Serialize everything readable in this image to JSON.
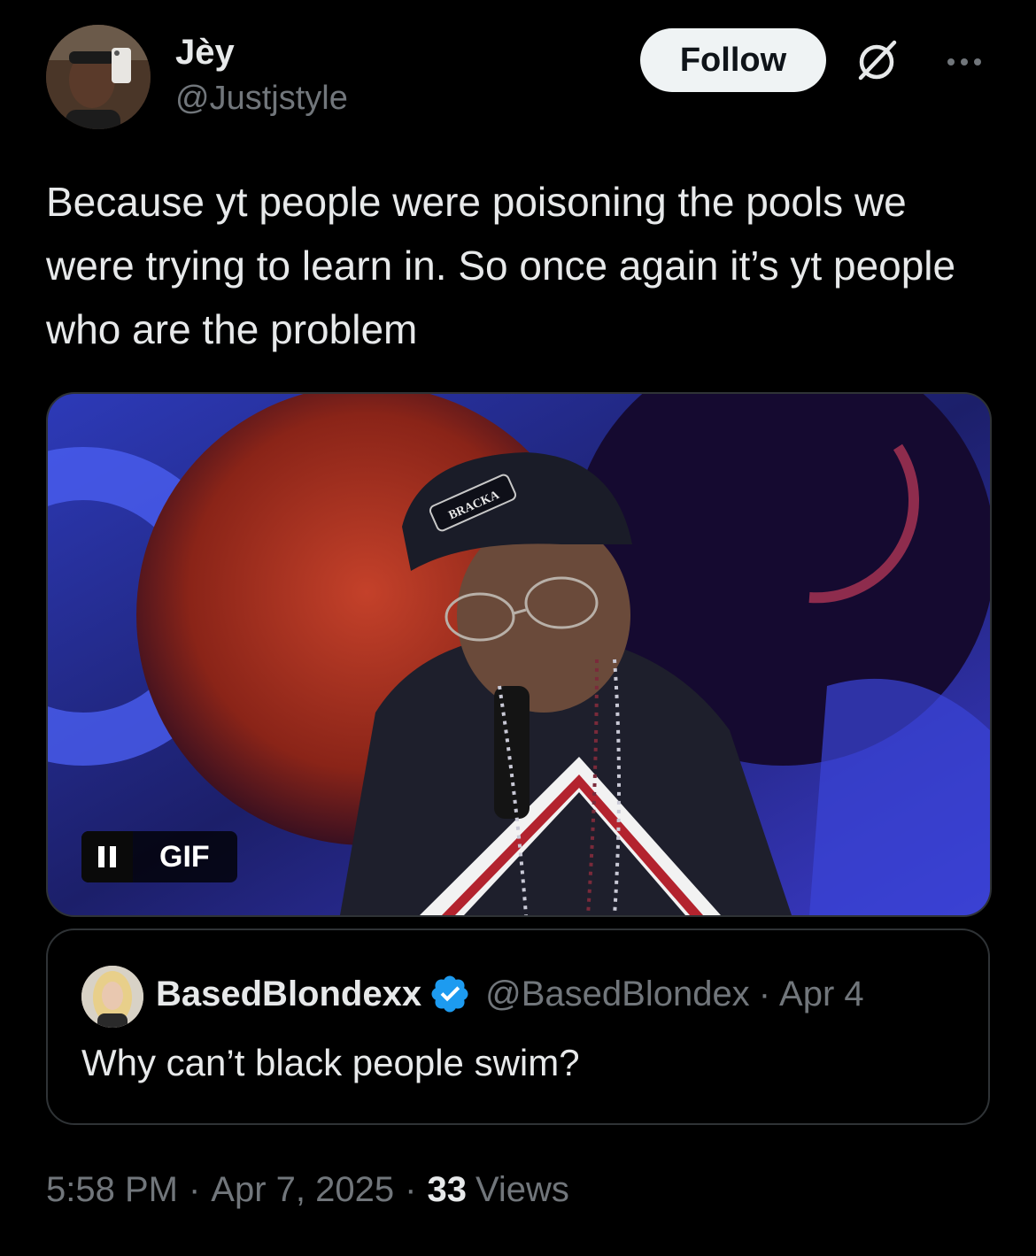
{
  "tweet": {
    "author": {
      "display_name": "Jèy",
      "handle": "@Justjstyle",
      "avatar_icon": "profile-photo"
    },
    "follow_label": "Follow",
    "text": "Because yt people were poisoning the pools we were trying to learn in. So once again it’s yt people who are the problem",
    "media": {
      "type_label": "GIF",
      "hat_text": "BRACKA"
    },
    "quoted": {
      "display_name": "BasedBlondexx",
      "verified": true,
      "handle": "@BasedBlondex",
      "separator": "·",
      "date": "Apr 4",
      "text": "Why can’t black people swim?"
    },
    "meta": {
      "time": "5:58 PM",
      "separator": "·",
      "date": "Apr 7, 2025",
      "views_count": "33",
      "views_label": "Views"
    }
  },
  "colors": {
    "background": "#000000",
    "text_primary": "#e7e9ea",
    "text_secondary": "#71767b",
    "border": "#2f3336",
    "verified_blue": "#1d9bf0",
    "follow_bg": "#eff3f4"
  }
}
